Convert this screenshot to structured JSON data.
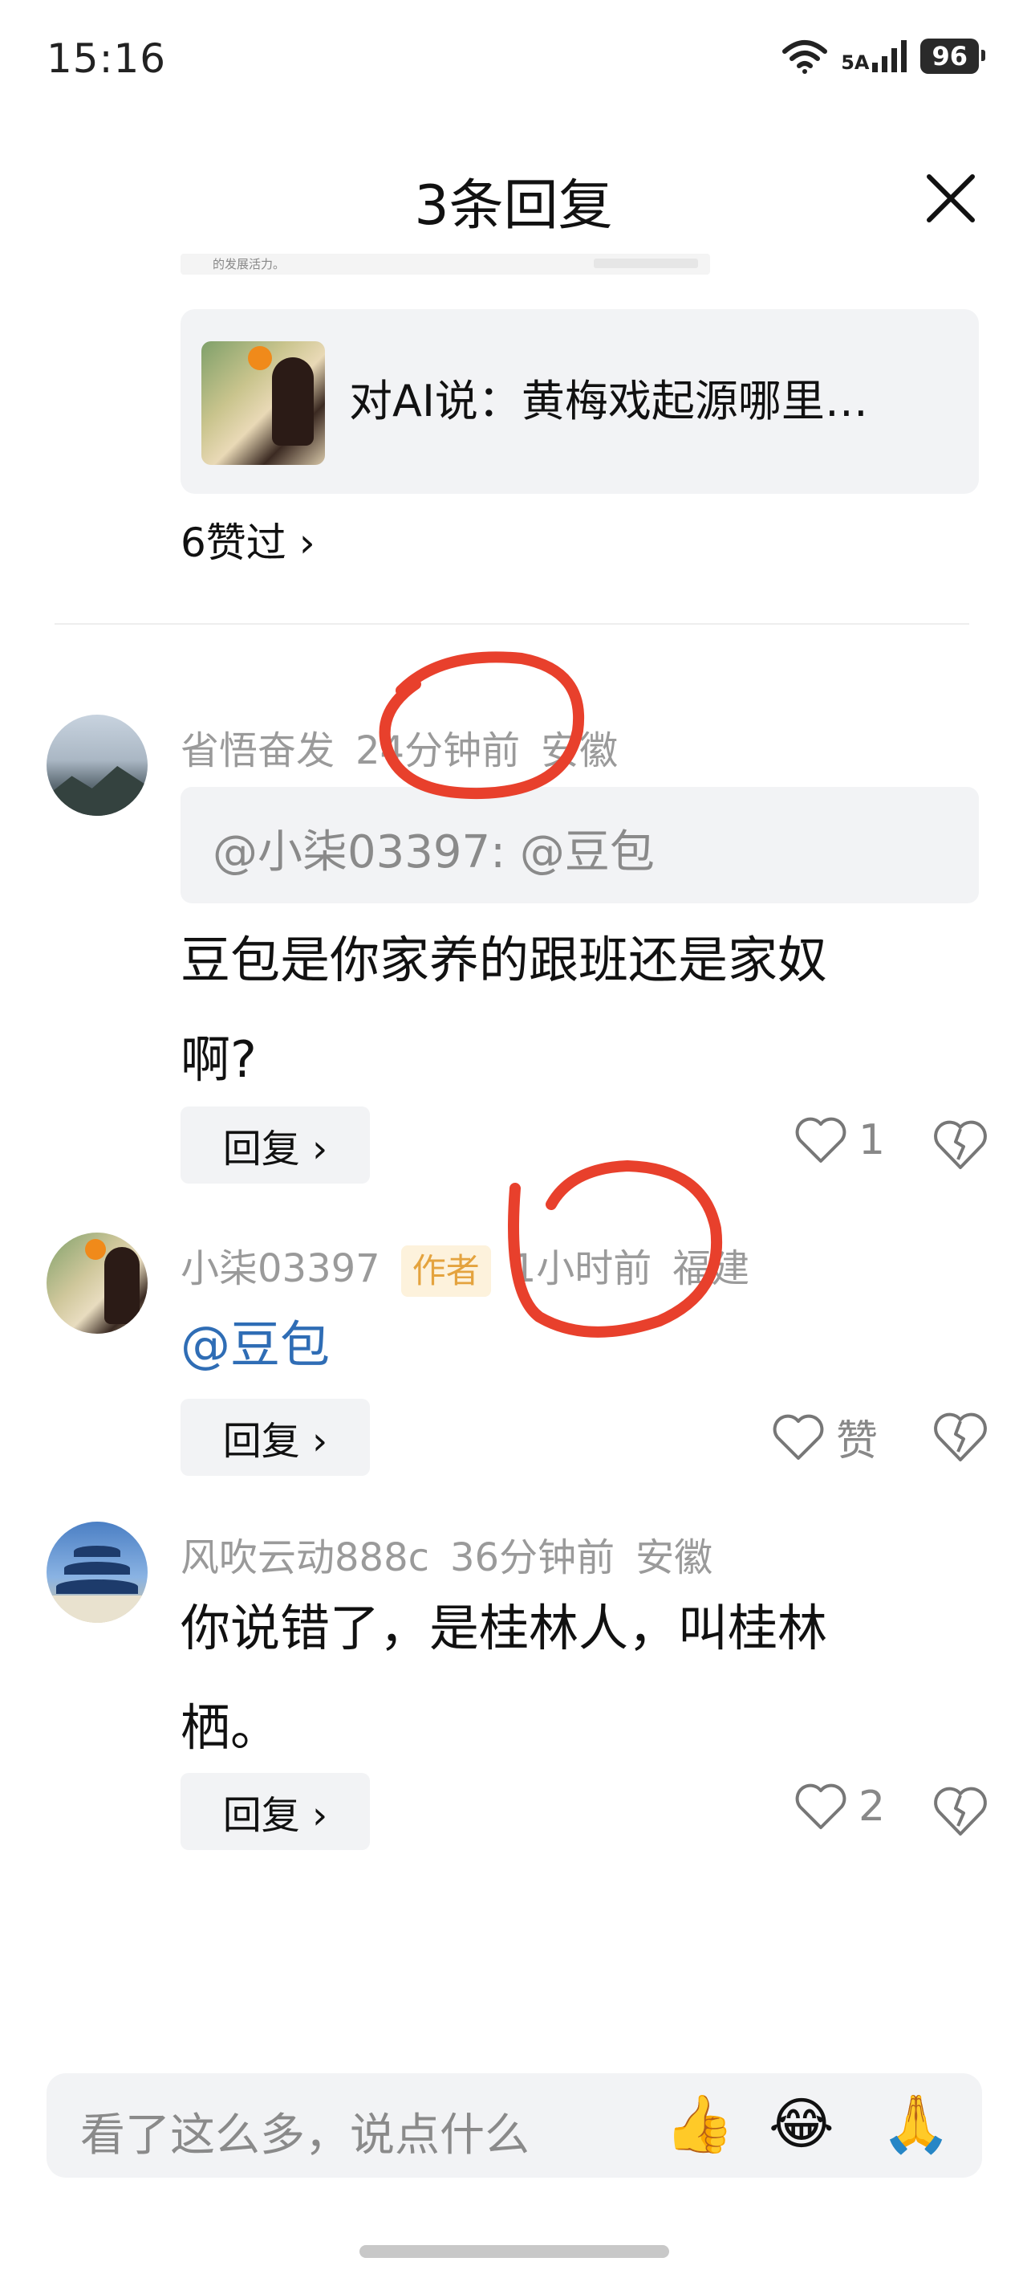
{
  "status_bar": {
    "time": "15:16",
    "network": "5A",
    "battery": "96"
  },
  "header": {
    "title": "3条回复"
  },
  "quote_card": {
    "text": "对AI说：黄梅戏起源哪里…",
    "remnant_text": "的发展活力。"
  },
  "likes_line": {
    "text": "6赞过 ›"
  },
  "comments": [
    {
      "username": "省悟奋发",
      "time": "24分钟前",
      "location": "安徽",
      "reply_ref": "@小柒03397: @豆包",
      "body_line1": "豆包是你家养的跟班还是家奴",
      "body_line2": "啊?",
      "reply_label": "回复 ›",
      "like_label": "1"
    },
    {
      "username": "小柒03397",
      "tag": "作者",
      "time": "1小时前",
      "location": "福建",
      "mention": "@豆包",
      "reply_label": "回复 ›",
      "like_label": "赞"
    },
    {
      "username": "风吹云动888c",
      "time": "36分钟前",
      "location": "安徽",
      "body_line1": "你说错了，是桂林人，叫桂林",
      "body_line2": "栖。",
      "reply_label": "回复 ›",
      "like_label": "2"
    }
  ],
  "input": {
    "placeholder": "看了这么多，说点什么"
  },
  "emojis": [
    "👍",
    "😂",
    "🙏"
  ],
  "colors": {
    "annotation": "#e8402c",
    "mention": "#2f6db5",
    "author_tag_bg": "#fdf2dc",
    "author_tag_text": "#e4a33e"
  }
}
